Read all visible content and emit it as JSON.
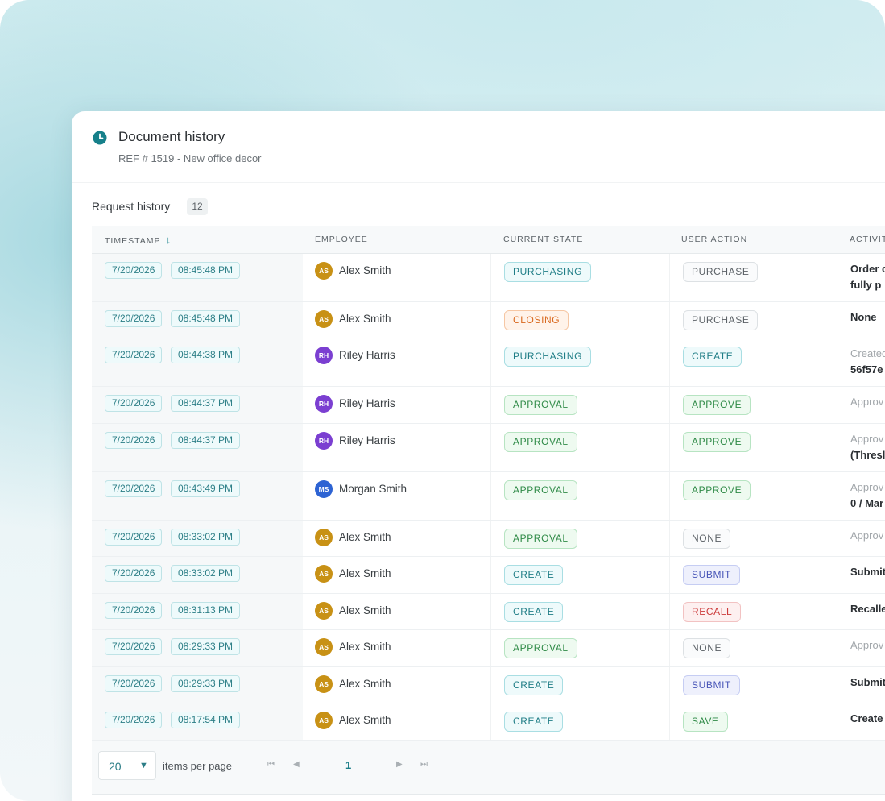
{
  "header": {
    "title": "Document history",
    "subtitle": "REF # 1519 - New office decor"
  },
  "section": {
    "title": "Request history",
    "count": "12"
  },
  "columns": {
    "timestamp": "TIMESTAMP",
    "employee": "EMPLOYEE",
    "current_state": "CURRENT STATE",
    "user_action": "USER ACTION",
    "activity": "ACTIVIT"
  },
  "colors": {
    "accent": "#16808a",
    "avatar_as": "#c89115",
    "avatar_rh": "#7b3fd1",
    "avatar_ms": "#2d63d3"
  },
  "rows": [
    {
      "date": "7/20/2026",
      "time": "08:45:48 PM",
      "initials": "AS",
      "employee": "Alex Smith",
      "state": "PURCHASING",
      "action": "PURCHASE",
      "activity1": "Order c",
      "activity2": "fully p"
    },
    {
      "date": "7/20/2026",
      "time": "08:45:48 PM",
      "initials": "AS",
      "employee": "Alex Smith",
      "state": "CLOSING",
      "action": "PURCHASE",
      "activity1": "None",
      "activity2": ""
    },
    {
      "date": "7/20/2026",
      "time": "08:44:38 PM",
      "initials": "RH",
      "employee": "Riley Harris",
      "state": "PURCHASING",
      "action": "CREATE",
      "activity1": "Created",
      "activity2": "56f57e"
    },
    {
      "date": "7/20/2026",
      "time": "08:44:37 PM",
      "initials": "RH",
      "employee": "Riley Harris",
      "state": "APPROVAL",
      "action": "APPROVE",
      "activity1": "Approv",
      "activity2": ""
    },
    {
      "date": "7/20/2026",
      "time": "08:44:37 PM",
      "initials": "RH",
      "employee": "Riley Harris",
      "state": "APPROVAL",
      "action": "APPROVE",
      "activity1": "Approv",
      "activity2": "(Thresl"
    },
    {
      "date": "7/20/2026",
      "time": "08:43:49 PM",
      "initials": "MS",
      "employee": "Morgan Smith",
      "state": "APPROVAL",
      "action": "APPROVE",
      "activity1": "Approv",
      "activity2": "0 / Mar"
    },
    {
      "date": "7/20/2026",
      "time": "08:33:02 PM",
      "initials": "AS",
      "employee": "Alex Smith",
      "state": "APPROVAL",
      "action": "NONE",
      "activity1": "Approv",
      "activity2": ""
    },
    {
      "date": "7/20/2026",
      "time": "08:33:02 PM",
      "initials": "AS",
      "employee": "Alex Smith",
      "state": "CREATE",
      "action": "SUBMIT",
      "activity1": "Submit",
      "activity2": ""
    },
    {
      "date": "7/20/2026",
      "time": "08:31:13 PM",
      "initials": "AS",
      "employee": "Alex Smith",
      "state": "CREATE",
      "action": "RECALL",
      "activity1": "Recalle",
      "activity2": ""
    },
    {
      "date": "7/20/2026",
      "time": "08:29:33 PM",
      "initials": "AS",
      "employee": "Alex Smith",
      "state": "APPROVAL",
      "action": "NONE",
      "activity1": "Approv",
      "activity2": ""
    },
    {
      "date": "7/20/2026",
      "time": "08:29:33 PM",
      "initials": "AS",
      "employee": "Alex Smith",
      "state": "CREATE",
      "action": "SUBMIT",
      "activity1": "Submit",
      "activity2": ""
    },
    {
      "date": "7/20/2026",
      "time": "08:17:54 PM",
      "initials": "AS",
      "employee": "Alex Smith",
      "state": "CREATE",
      "action": "SAVE",
      "activity1": "Create",
      "activity2": ""
    }
  ],
  "pagination": {
    "per_page": "20",
    "per_page_label": "items per page",
    "current_page": "1",
    "first_icon": "first-page-icon",
    "prev_icon": "prev-page-icon",
    "next_icon": "next-page-icon",
    "last_icon": "last-page-icon"
  }
}
